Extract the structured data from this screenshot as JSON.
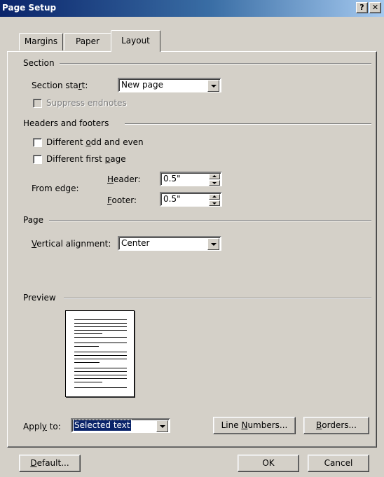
{
  "window": {
    "title": "Page Setup",
    "help_button": "?",
    "close_button": "✕"
  },
  "tabs": [
    {
      "label": "Margins"
    },
    {
      "label": "Paper"
    },
    {
      "label": "Layout",
      "active": true
    }
  ],
  "section": {
    "heading": "Section",
    "start_label_pre": "Section sta",
    "start_label_key": "r",
    "start_label_post": "t:",
    "start_value": "New page",
    "suppress_endnotes": "Suppress endnotes"
  },
  "headers_footers": {
    "heading": "Headers and footers",
    "odd_even_pre": "Different ",
    "odd_even_key": "o",
    "odd_even_post": "dd and even",
    "first_page_pre": "Different first ",
    "first_page_key": "p",
    "first_page_post": "age",
    "from_edge_label": "From edge:",
    "header_key": "H",
    "header_rest": "eader:",
    "header_value": "0.5\"",
    "footer_key": "F",
    "footer_rest": "ooter:",
    "footer_value": "0.5\""
  },
  "page": {
    "heading": "Page",
    "valign_key": "V",
    "valign_rest": "ertical alignment:",
    "valign_value": "Center"
  },
  "preview": {
    "heading": "Preview"
  },
  "apply": {
    "label_pre": "Appl",
    "label_key": "y",
    "label_post": " to:",
    "value": "Selected text"
  },
  "buttons": {
    "line_numbers_pre": "Line ",
    "line_numbers_key": "N",
    "line_numbers_post": "umbers...",
    "borders_key": "B",
    "borders_post": "orders...",
    "default_key": "D",
    "default_post": "efault...",
    "ok": "OK",
    "cancel": "Cancel"
  }
}
